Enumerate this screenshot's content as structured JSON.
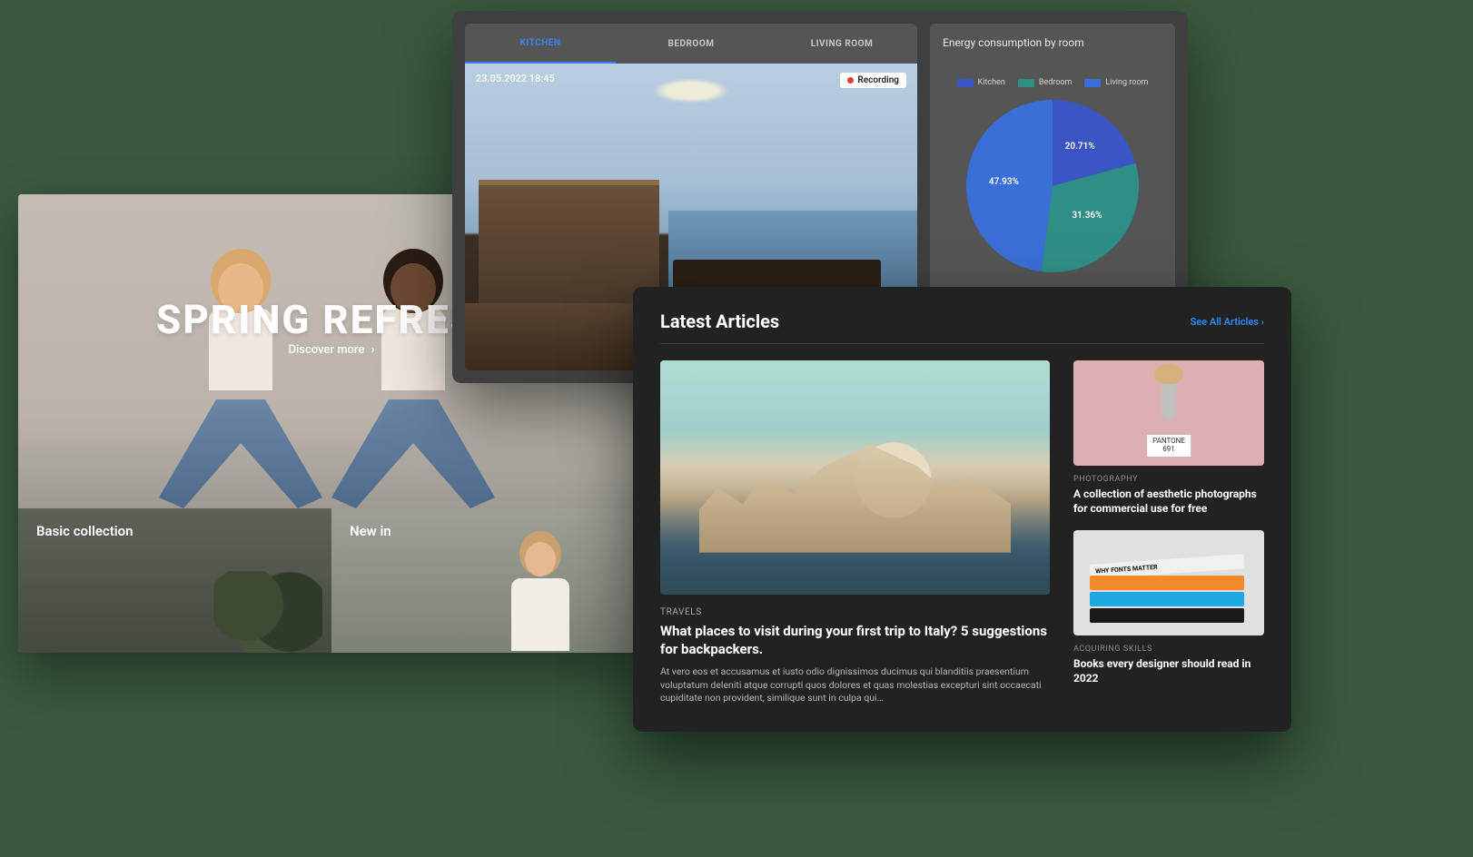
{
  "spring": {
    "title": "SPRING REFRESH",
    "cta": "Discover more",
    "tiles": {
      "basic": "Basic collection",
      "newin": "New in"
    }
  },
  "home": {
    "tabs": [
      "KITCHEN",
      "BEDROOM",
      "LIVING ROOM"
    ],
    "active_tab_index": 0,
    "camera": {
      "timestamp": "23.05.2022 18:45",
      "recording_label": "Recording"
    },
    "energy": {
      "title": "Energy consumption by room",
      "legend": [
        {
          "label": "Kitchen",
          "color": "#3b55c4"
        },
        {
          "label": "Bedroom",
          "color": "#2f8f86"
        },
        {
          "label": "Living room",
          "color": "#3a6fd8"
        }
      ]
    }
  },
  "chart_data": {
    "type": "pie",
    "title": "Energy consumption by room",
    "series": [
      {
        "name": "Kitchen",
        "value": 20.71,
        "color": "#3b55c4"
      },
      {
        "name": "Bedroom",
        "value": 31.36,
        "color": "#2f8f86"
      },
      {
        "name": "Living room",
        "value": 47.93,
        "color": "#3a6fd8"
      }
    ]
  },
  "articles": {
    "heading": "Latest Articles",
    "see_all": "See All Articles",
    "main": {
      "category": "TRAVELS",
      "headline": "What places to visit during your first trip to Italy? 5 suggestions for backpackers.",
      "excerpt": "At vero eos et accusamus et iusto odio dignissimos ducimus qui blanditiis praesentium voluptatum deleniti atque corrupti quos dolores et quas molestias excepturi sint occaecati cupiditate non provident, similique sunt in culpa qui…"
    },
    "side": [
      {
        "category": "PHOTOGRAPHY",
        "headline": "A collection of aesthetic photographs for commercial use for free",
        "pantone_label": "PANTONE",
        "pantone_code": "691"
      },
      {
        "category": "ACQUIRING SKILLS",
        "headline": "Books every designer should read in 2022",
        "book_spine": "WHY FONTS MATTER"
      }
    ]
  }
}
